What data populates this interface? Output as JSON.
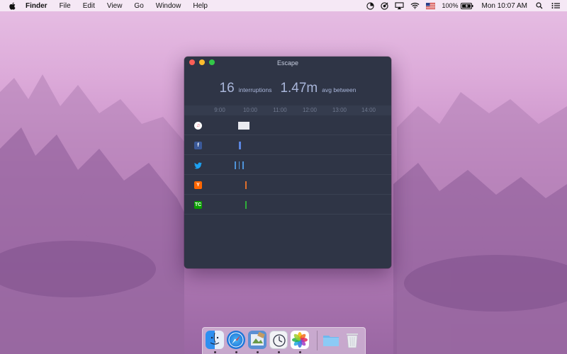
{
  "menubar": {
    "apple_icon": "apple-icon",
    "app_name": "Finder",
    "menus": [
      "File",
      "Edit",
      "View",
      "Go",
      "Window",
      "Help"
    ],
    "battery_percent": "100%",
    "datetime": "Mon 10:07 AM",
    "status_icons": [
      "timer-icon",
      "target-icon",
      "airplay-icon",
      "wifi-icon",
      "us-flag-icon",
      "battery-charging-icon",
      "spotlight-search-icon",
      "notification-center-icon"
    ]
  },
  "window": {
    "title": "Escape",
    "interruptions_count": "16",
    "interruptions_label": "interruptions",
    "avg_value": "1.47m",
    "avg_label": "avg between",
    "time_ticks": [
      "9:00",
      "10:00",
      "11:00",
      "12:00",
      "13:00",
      "14:00"
    ],
    "rows": [
      {
        "app": "itunes-icon",
        "glyph": "♫",
        "color": "#e9475f",
        "marks": 8,
        "mark_color": "#e9eaf0"
      },
      {
        "app": "facebook-icon",
        "glyph": "f",
        "color": "#3b5998",
        "marks": 2,
        "mark_color": "#5b86e0"
      },
      {
        "app": "twitter-icon",
        "glyph": "🐦",
        "color": "#1da1f2",
        "marks": 3,
        "mark_color": "#4f93d8"
      },
      {
        "app": "hacker-news-icon",
        "glyph": "Y",
        "color": "#ff6600",
        "marks": 1,
        "mark_color": "#e06f2c"
      },
      {
        "app": "techcrunch-icon",
        "glyph": "TC",
        "color": "#0a9e01",
        "marks": 1,
        "mark_color": "#2fae3a"
      }
    ]
  },
  "dock": {
    "items": [
      "finder-icon",
      "safari-icon",
      "preview-icon",
      "escape-app-icon",
      "photos-icon",
      "downloads-folder-icon",
      "trash-icon"
    ]
  }
}
